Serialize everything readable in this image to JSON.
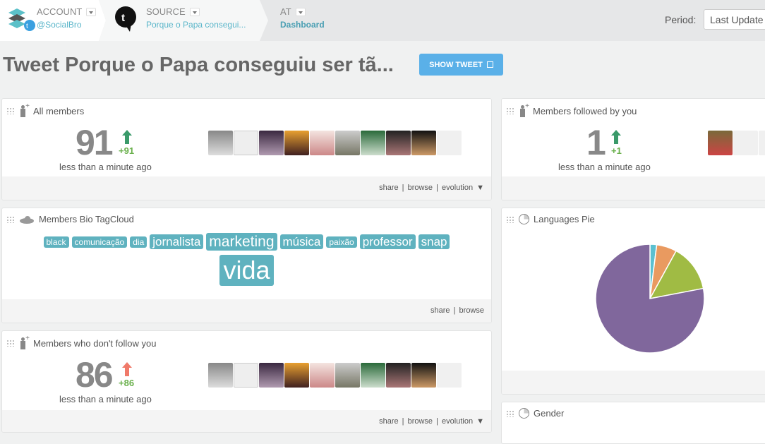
{
  "topbar": {
    "account": {
      "label": "ACCOUNT",
      "value": "@SocialBro"
    },
    "source": {
      "label": "SOURCE",
      "value": "Porque o Papa consegui..."
    },
    "at": {
      "label": "AT",
      "value": "Dashboard"
    },
    "period": {
      "label": "Period:",
      "value": "Last Update"
    }
  },
  "page": {
    "title": "Tweet Porque o Papa conseguiu ser tã...",
    "show_tweet": "SHOW TWEET"
  },
  "colors": {
    "accent": "#5ab0e8",
    "tag": "#5fb2bf",
    "up_green": "#3a9a6a",
    "up_red": "#f07a6a",
    "delta": "#6ab04c"
  },
  "widgets": {
    "all_members": {
      "title": "All members",
      "count": "91",
      "delta": "+91",
      "trend": "up",
      "time": "less than a minute ago",
      "actions": [
        "share",
        "| browse",
        "| evolution ▼"
      ]
    },
    "followed": {
      "title": "Members followed by you",
      "count": "1",
      "delta": "+1",
      "trend": "up",
      "time": "less than a minute ago"
    },
    "tagcloud": {
      "title": "Members Bio TagCloud",
      "tags": [
        {
          "text": "black",
          "weight": 1
        },
        {
          "text": "comunicação",
          "weight": 1
        },
        {
          "text": "dia",
          "weight": 1
        },
        {
          "text": "jornalista",
          "weight": 2
        },
        {
          "text": "marketing",
          "weight": 3
        },
        {
          "text": "música",
          "weight": 2
        },
        {
          "text": "paixão",
          "weight": 1
        },
        {
          "text": "professor",
          "weight": 2
        },
        {
          "text": "snap",
          "weight": 2
        },
        {
          "text": "vida",
          "weight": 5
        }
      ],
      "actions": [
        "share",
        "| browse"
      ]
    },
    "languages": {
      "title": "Languages Pie"
    },
    "not_follow": {
      "title": "Members who don't follow you",
      "count": "86",
      "delta": "+86",
      "trend": "up",
      "time": "less than a minute ago",
      "actions": [
        "share",
        "| browse",
        "| evolution ▼"
      ]
    },
    "gender": {
      "title": "Gender"
    }
  },
  "chart_data": {
    "type": "pie",
    "values": [
      2,
      6,
      14,
      78
    ],
    "colors": [
      "#5bc0d0",
      "#e99a60",
      "#a0bb44",
      "#80679c"
    ]
  }
}
